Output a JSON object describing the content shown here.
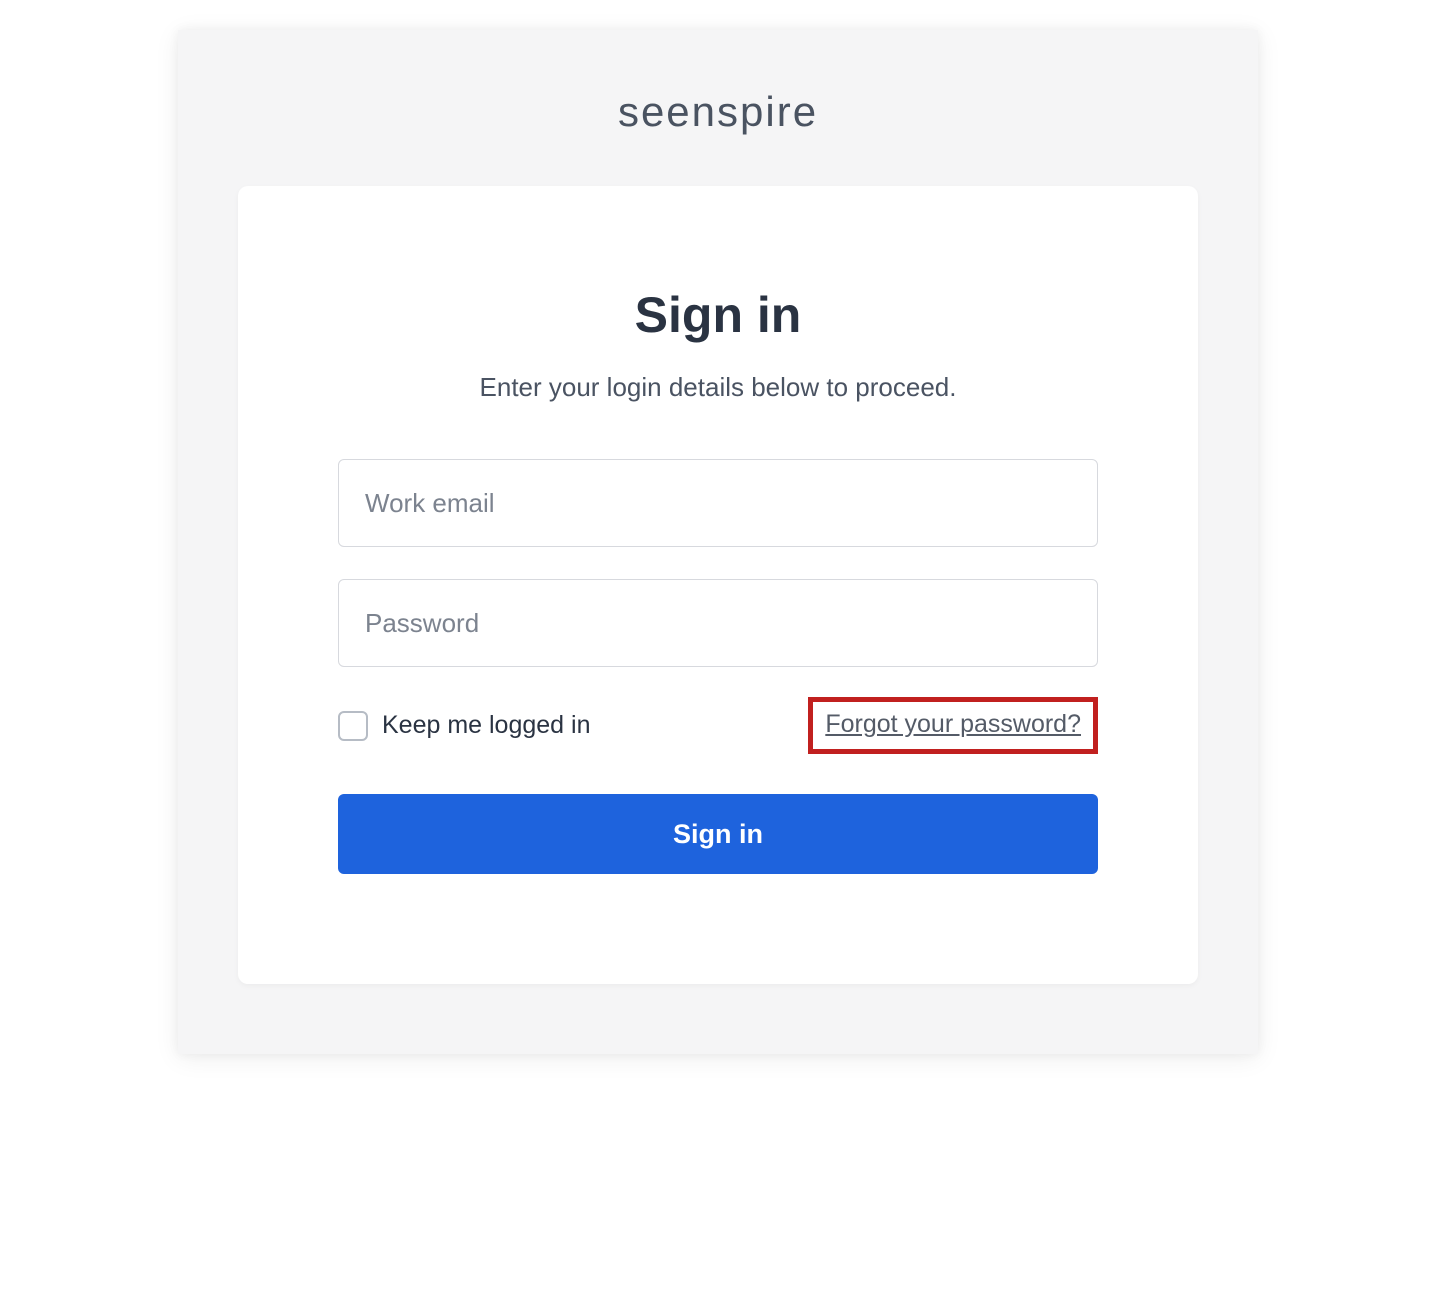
{
  "brand": {
    "name": "seenspire"
  },
  "signin": {
    "heading": "Sign in",
    "subheading": "Enter your login details below to proceed.",
    "email": {
      "placeholder": "Work email",
      "value": ""
    },
    "password": {
      "placeholder": "Password",
      "value": ""
    },
    "keep_logged_label": "Keep me logged in",
    "forgot_link": "Forgot your password?",
    "submit_label": "Sign in"
  }
}
